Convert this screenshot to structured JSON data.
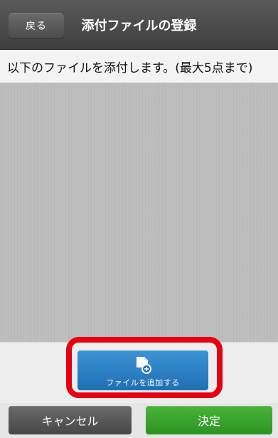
{
  "header": {
    "back_label": "戻る",
    "title": "添付ファイルの登録"
  },
  "instruction": {
    "text": "以下のファイルを添付します。(最大5点まで)"
  },
  "attachments": [],
  "add_file": {
    "label": "ファイルを追加する",
    "icon": "file-add-icon"
  },
  "footer": {
    "cancel_label": "キャンセル",
    "confirm_label": "決定"
  },
  "colors": {
    "header": "#4a4a4a",
    "highlight": "#e60012",
    "add_button": "#2a7fc6",
    "confirm_button": "#35a22a",
    "cancel_button": "#555555",
    "content_area": "#bdbdbd"
  }
}
